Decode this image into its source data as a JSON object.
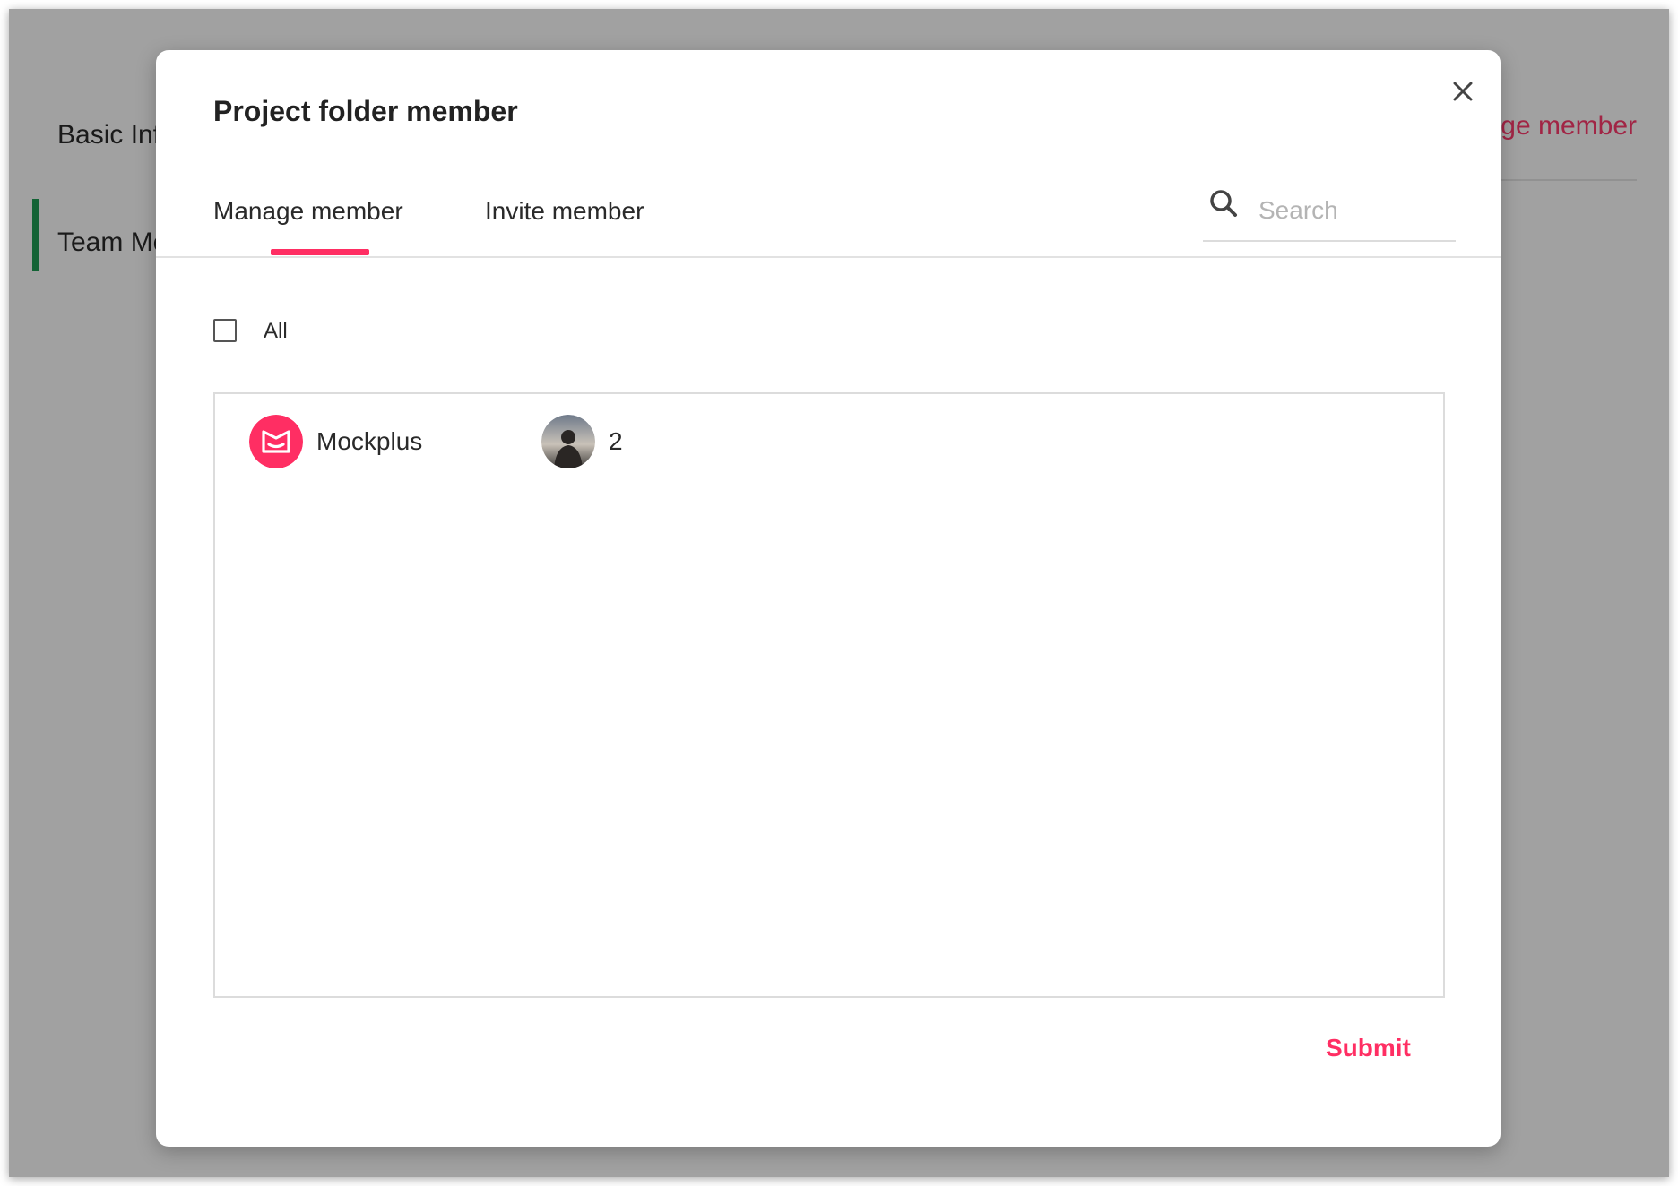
{
  "background": {
    "nav_items": [
      "Basic Inf",
      "Team Me"
    ],
    "right_link": "ge member"
  },
  "modal": {
    "title": "Project folder member",
    "tabs": [
      {
        "label": "Manage member",
        "active": true
      },
      {
        "label": "Invite member",
        "active": false
      }
    ],
    "search": {
      "placeholder": "Search",
      "value": ""
    },
    "select_all": {
      "label": "All",
      "checked": false
    },
    "members": [
      {
        "name": "Mockplus",
        "avatar": "mockplus-logo-icon"
      },
      {
        "name": "2",
        "avatar": "photo-avatar"
      }
    ],
    "submit_label": "Submit"
  },
  "colors": {
    "accent": "#ff2e63",
    "active_nav_bar": "#1f9d55"
  }
}
